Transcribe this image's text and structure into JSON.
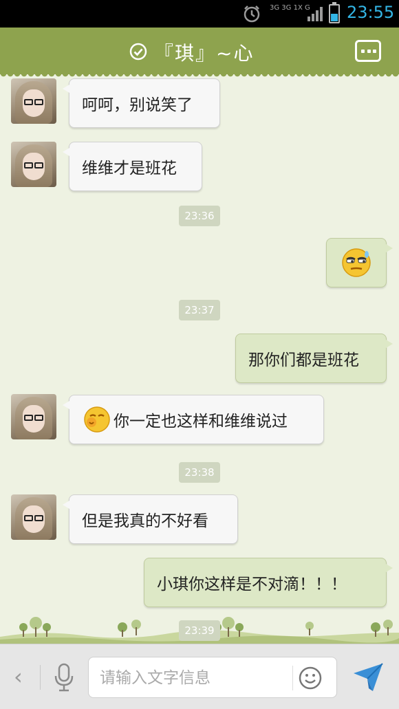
{
  "status_bar": {
    "network_label": "3G 3G 1X G",
    "time": "23:55",
    "battery_level": 0.45,
    "icons": [
      "alarm-icon",
      "network-icon",
      "signal-icon",
      "battery-icon"
    ]
  },
  "header": {
    "title": "『琪』~心",
    "icons": [
      "check-circle-icon",
      "more-menu-icon"
    ],
    "accent_color": "#8ea34e"
  },
  "messages": [
    {
      "side": "left",
      "text": "呵呵，别说笑了"
    },
    {
      "side": "left",
      "text": "维维才是班花"
    },
    {
      "type": "timestamp",
      "text": "23:36"
    },
    {
      "side": "right",
      "emoji": "smug-face-emoji"
    },
    {
      "type": "timestamp",
      "text": "23:37"
    },
    {
      "side": "right",
      "text": "那你们都是班花"
    },
    {
      "side": "left",
      "emoji": "giggle-emoji",
      "text": "你一定也这样和维维说过"
    },
    {
      "type": "timestamp",
      "text": "23:38"
    },
    {
      "side": "left",
      "text": "但是我真的不好看"
    },
    {
      "side": "right",
      "text": "小琪你这样是不对滴！！！"
    },
    {
      "type": "timestamp",
      "text": "23:39"
    }
  ],
  "input_bar": {
    "placeholder": "请输入文字信息",
    "icons": [
      "back-chevron-icon",
      "microphone-icon",
      "smiley-icon",
      "send-icon"
    ],
    "send_color": "#3a8fd6"
  }
}
